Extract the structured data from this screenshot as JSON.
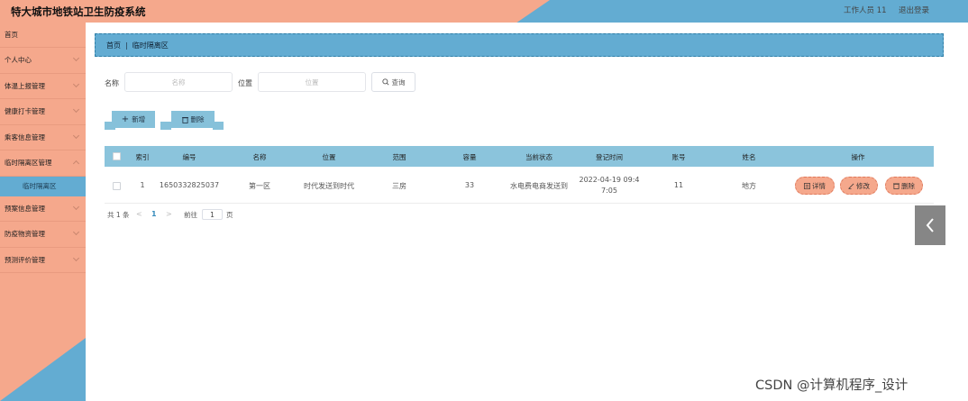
{
  "header": {
    "title": "特大城市地铁站卫生防疫系统",
    "user": "工作人员 11",
    "logout": "退出登录"
  },
  "sidebar": {
    "items": [
      {
        "label": "首页"
      },
      {
        "label": "个人中心"
      },
      {
        "label": "体温上报管理"
      },
      {
        "label": "健康打卡管理"
      },
      {
        "label": "乘客信息管理"
      },
      {
        "label": "临时隔离区管理",
        "expanded": true,
        "children": [
          {
            "label": "临时隔离区"
          }
        ]
      },
      {
        "label": "预案信息管理"
      },
      {
        "label": "防疫物资管理"
      },
      {
        "label": "预测评价管理"
      }
    ]
  },
  "breadcrumb": {
    "home": "首页",
    "current": "临时隔离区"
  },
  "search": {
    "name_label": "名称",
    "name_placeholder": "名称",
    "position_label": "位置",
    "position_placeholder": "位置",
    "search_button": "查询"
  },
  "actions": {
    "add": "新增",
    "delete": "删除"
  },
  "table": {
    "headers": [
      "索引",
      "编号",
      "名称",
      "位置",
      "范围",
      "容量",
      "当前状态",
      "登记时间",
      "账号",
      "姓名",
      "操作"
    ],
    "rows": [
      {
        "index": "1",
        "code": "1650332825037",
        "name": "第一区",
        "position": "时代发送到时代",
        "range": "三房",
        "capacity": "33",
        "status": "水电费电商发送到",
        "time": "2022-04-19 09:4 7:05",
        "account": "11",
        "person": "地方",
        "ops": [
          "详情",
          "修改",
          "删除"
        ]
      }
    ]
  },
  "pagination": {
    "total": "共 1 条",
    "prev": "<",
    "current": "1",
    "next": ">",
    "goto_label": "前往",
    "goto_value": "1",
    "page_suffix": "页"
  },
  "side_toggle": {
    "icon": "chevron-left-icon"
  },
  "watermark": "CSDN @计算机程序_设计",
  "colors": {
    "salmon": "#f5a88c",
    "blue": "#63acd2",
    "table_header": "#8bc4dc"
  }
}
